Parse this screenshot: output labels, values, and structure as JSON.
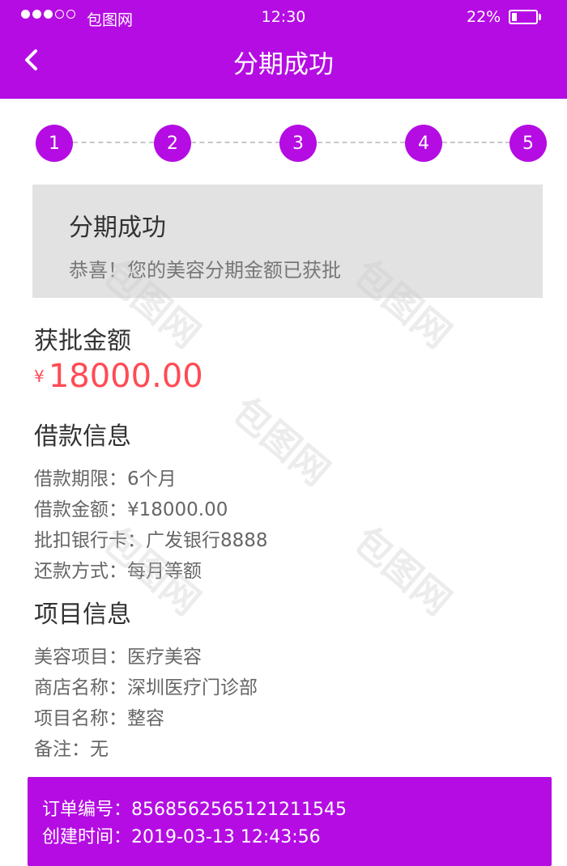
{
  "status_bar": {
    "carrier": "包图网",
    "time": "12:30",
    "battery": "22%",
    "battery_level": 0.22,
    "signal_strength": 3,
    "signal_max": 5
  },
  "nav": {
    "title": "分期成功"
  },
  "steps": [
    "1",
    "2",
    "3",
    "4",
    "5"
  ],
  "success_box": {
    "title": "分期成功",
    "subtitle": "恭喜！您的美容分期金额已获批"
  },
  "approved": {
    "title": "获批金额",
    "currency": "¥",
    "amount": "18000.00"
  },
  "loan_info": {
    "title": "借款信息",
    "rows": [
      {
        "label": "借款期限：",
        "value": "6个月"
      },
      {
        "label": "借款金额：",
        "value": "¥18000.00"
      },
      {
        "label": "批扣银行卡：",
        "value": "广发银行8888"
      },
      {
        "label": "还款方式：",
        "value": "每月等额"
      }
    ]
  },
  "project_info": {
    "title": "项目信息",
    "rows": [
      {
        "label": "美容项目：",
        "value": "医疗美容"
      },
      {
        "label": "商店名称：",
        "value": "深圳医疗门诊部"
      },
      {
        "label": "项目名称：",
        "value": "整容"
      },
      {
        "label": "备注：",
        "value": "无"
      }
    ]
  },
  "order": {
    "rows": [
      {
        "label": "订单编号：",
        "value": "8568562565121211545"
      },
      {
        "label": "创建时间：",
        "value": "2019-03-13 12:43:56"
      }
    ]
  },
  "watermark": "包图网",
  "colors": {
    "accent": "#b50ce3",
    "amount": "#ff4b55",
    "success_box_bg": "#e2e2e2"
  }
}
